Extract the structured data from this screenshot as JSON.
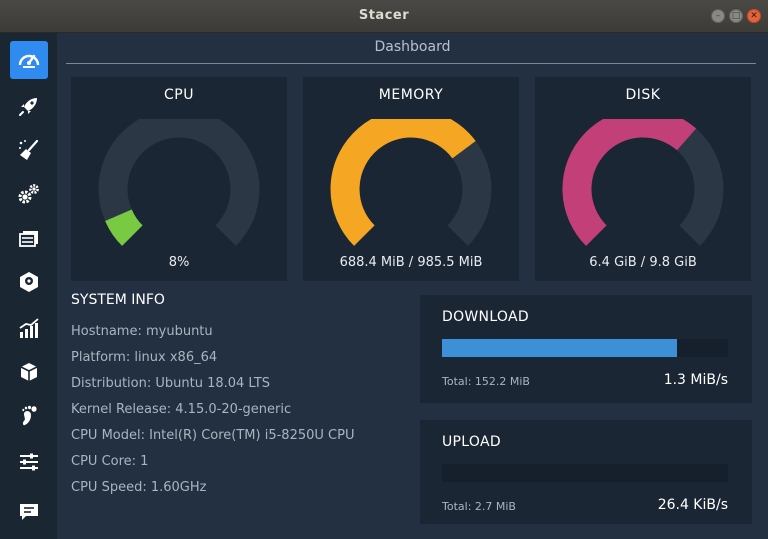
{
  "window": {
    "title": "Stacer"
  },
  "page": {
    "title": "Dashboard"
  },
  "sidebar": {
    "items": [
      {
        "name": "dashboard",
        "icon": "speedometer-icon",
        "active": true
      },
      {
        "name": "startup-apps",
        "icon": "rocket-icon",
        "active": false
      },
      {
        "name": "system-cleaner",
        "icon": "broom-icon",
        "active": false
      },
      {
        "name": "services",
        "icon": "gears-icon",
        "active": false
      },
      {
        "name": "processes",
        "icon": "processes-icon",
        "active": false
      },
      {
        "name": "uninstaller",
        "icon": "package-box-icon",
        "active": false
      },
      {
        "name": "resources",
        "icon": "chart-icon",
        "active": false
      },
      {
        "name": "apt-repository",
        "icon": "cube-icon",
        "active": false
      },
      {
        "name": "gnome-settings",
        "icon": "gnome-foot-icon",
        "active": false
      },
      {
        "name": "settings",
        "icon": "sliders-icon",
        "active": false
      },
      {
        "name": "feedback",
        "icon": "chat-icon",
        "active": false
      }
    ]
  },
  "gauges": {
    "cpu": {
      "label": "CPU",
      "value_text": "8%",
      "fraction": 0.08,
      "color": "#7ac943"
    },
    "memory": {
      "label": "MEMORY",
      "value_text": "688.4 MiB / 985.5 MiB",
      "fraction": 0.698,
      "color": "#f5a623"
    },
    "disk": {
      "label": "DISK",
      "value_text": "6.4 GiB / 9.8 GiB",
      "fraction": 0.653,
      "color": "#c23f78"
    }
  },
  "system_info": {
    "title": "SYSTEM INFO",
    "lines": [
      "Hostname: myubuntu",
      "Platform: linux x86_64",
      "Distribution: Ubuntu 18.04 LTS",
      "Kernel Release: 4.15.0-20-generic",
      "CPU Model: Intel(R) Core(TM) i5-8250U CPU",
      "CPU Core: 1",
      "CPU Speed: 1.60GHz"
    ]
  },
  "network": {
    "download": {
      "title": "DOWNLOAD",
      "total": "Total: 152.2 MiB",
      "speed": "1.3 MiB/s",
      "fraction": 0.82
    },
    "upload": {
      "title": "UPLOAD",
      "total": "Total: 2.7 MiB",
      "speed": "26.4 KiB/s",
      "fraction": 0.0
    }
  },
  "colors": {
    "gauge_track": "#2b3744",
    "accent": "#2f8bf0",
    "bar_fill": "#3d8fd8"
  }
}
